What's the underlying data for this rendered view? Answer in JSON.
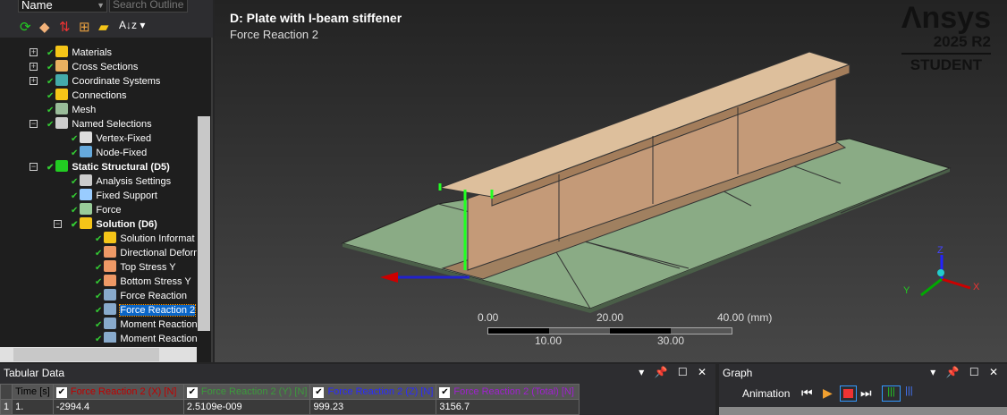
{
  "outline": {
    "name_select": "Name",
    "search_placeholder": "Search Outline",
    "items": [
      {
        "label": "Materials",
        "level": 1,
        "expander": "+"
      },
      {
        "label": "Cross Sections",
        "level": 1,
        "expander": "+"
      },
      {
        "label": "Coordinate Systems",
        "level": 1,
        "expander": "+"
      },
      {
        "label": "Connections",
        "level": 1
      },
      {
        "label": "Mesh",
        "level": 1
      },
      {
        "label": "Named Selections",
        "level": 1,
        "expander": "-"
      },
      {
        "label": "Vertex-Fixed",
        "level": 2
      },
      {
        "label": "Node-Fixed",
        "level": 2
      },
      {
        "label": "Static Structural (D5)",
        "level": 1,
        "expander": "-",
        "bold": true
      },
      {
        "label": "Analysis Settings",
        "level": 2
      },
      {
        "label": "Fixed Support",
        "level": 2
      },
      {
        "label": "Force",
        "level": 2
      },
      {
        "label": "Solution (D6)",
        "level": 2,
        "expander": "-",
        "bold": true
      },
      {
        "label": "Solution Informat",
        "level": 3
      },
      {
        "label": "Directional Deforn",
        "level": 3
      },
      {
        "label": "Top Stress Y",
        "level": 3
      },
      {
        "label": "Bottom Stress Y",
        "level": 3
      },
      {
        "label": "Force Reaction",
        "level": 3
      },
      {
        "label": "Force Reaction 2",
        "level": 3,
        "selected": true
      },
      {
        "label": "Moment Reaction",
        "level": 3
      },
      {
        "label": "Moment Reaction",
        "level": 3
      }
    ]
  },
  "viewport": {
    "title": "D: Plate with I-beam stiffener",
    "subtitle": "Force Reaction 2",
    "logo": {
      "brand": "Ansys",
      "version": "2025 R2",
      "edition": "STUDENT"
    },
    "scale": {
      "top": [
        "0.00",
        "20.00",
        "40.00 (mm)"
      ],
      "bottom": [
        "10.00",
        "30.00"
      ]
    },
    "axes": {
      "x": "X",
      "y": "Y",
      "z": "Z"
    }
  },
  "tabular": {
    "title": "Tabular Data",
    "columns": [
      {
        "label": "Time [s]"
      },
      {
        "label": "Force Reaction 2 (X) [N]",
        "color": "#c00000"
      },
      {
        "label": "Force Reaction 2 (Y) [N]",
        "color": "#3c9a3c"
      },
      {
        "label": "Force Reaction 2 (Z) [N]",
        "color": "#2a2aff"
      },
      {
        "label": "Force Reaction 2 (Total) [N]",
        "color": "#a020d0"
      }
    ],
    "rows": [
      [
        "1",
        "1.",
        "-2994.4",
        "2.5109e-009",
        "999.23",
        "3156.7"
      ]
    ]
  },
  "graph": {
    "title": "Graph",
    "animation_label": "Animation"
  }
}
